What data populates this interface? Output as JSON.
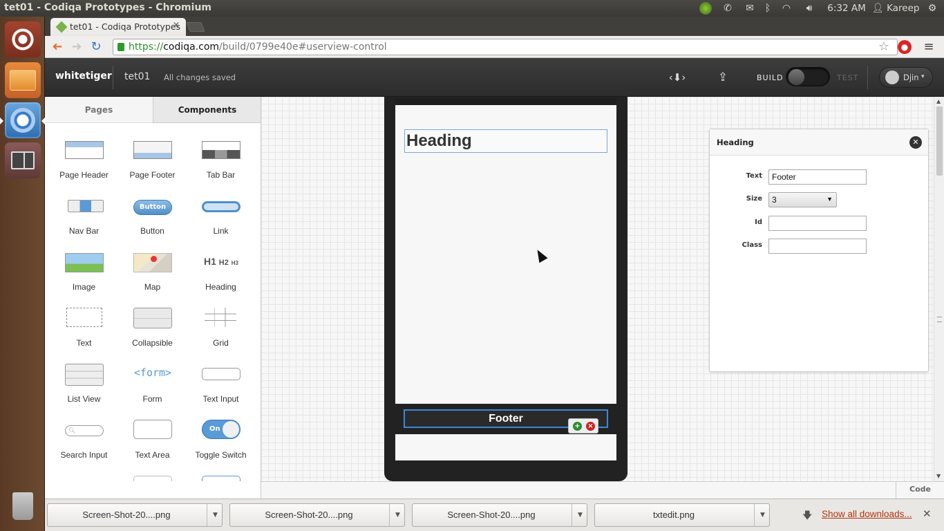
{
  "window": {
    "title": "tet01 - Codiqa Prototypes - Chromium"
  },
  "system_tray": {
    "clock": "6:32 AM",
    "user": "Kareep"
  },
  "browser": {
    "tab_title": "tet01 - Codiqa Prototypes",
    "tab_close": "×",
    "url_scheme": "https://",
    "url_host": "codiqa.com",
    "url_path": "/build/0799e40e#userview-control"
  },
  "app": {
    "brand": "whitetiger",
    "project": "tet01",
    "save_status": "All changes saved",
    "build_label": "BUILD",
    "test_label": "TEST",
    "user": "Djin",
    "mode": "build"
  },
  "sidebar": {
    "tabs": [
      "Pages",
      "Components"
    ],
    "active_tab": "Components",
    "components": [
      "Page Header",
      "Page Footer",
      "Tab Bar",
      "Nav Bar",
      "Button",
      "Link",
      "Image",
      "Map",
      "Heading",
      "Text",
      "Collapsible",
      "Grid",
      "List View",
      "Form",
      "Text Input",
      "Search Input",
      "Text Area",
      "Toggle Switch"
    ],
    "button_icon_text": "Button",
    "form_icon_text": "<form>",
    "toggle_icon_text": "On",
    "heading_icon": {
      "h1": "H1",
      "h2": "H2",
      "h3": "H3"
    }
  },
  "canvas": {
    "heading_text": "Heading",
    "footer_text": "Footer"
  },
  "properties": {
    "title": "Heading",
    "fields": [
      {
        "label": "Text",
        "value": "Footer"
      },
      {
        "label": "Size",
        "value": "3"
      },
      {
        "label": "Id",
        "value": ""
      },
      {
        "label": "Class",
        "value": ""
      }
    ]
  },
  "code_button": "Code",
  "downloads": {
    "items": [
      "Screen-Shot-20....png",
      "Screen-Shot-20....png",
      "Screen-Shot-20....png",
      "txtedit.png"
    ],
    "show_all": "Show all downloads..."
  }
}
